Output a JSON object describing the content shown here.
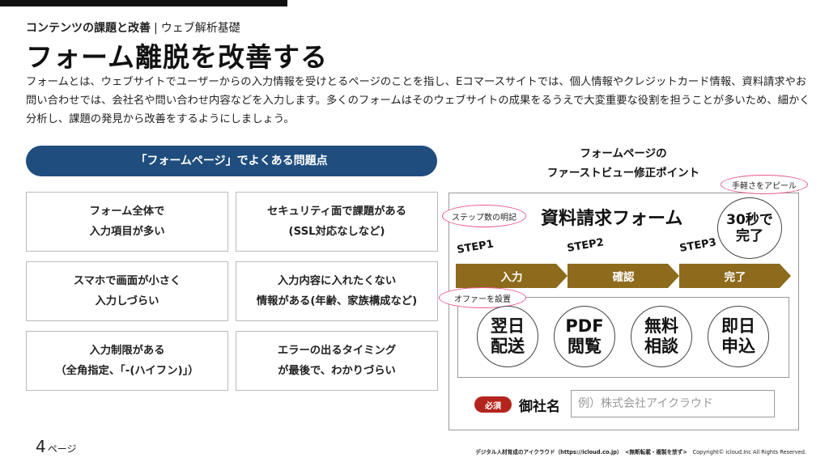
{
  "header": {
    "breadcrumb_main": "コンテンツの課題と改善",
    "breadcrumb_sep": "|",
    "breadcrumb_sub": "ウェブ解析基礎",
    "title": "フォーム離脱を改善する",
    "intro": "フォームとは、ウェブサイトでユーザーからの入力情報を受けとるページのことを指し、Eコマースサイトでは、個人情報やクレジットカード情報、資料請求やお問い合わせでは、会社名や問い合わせ内容などを入力します。多くのフォームはそのウェブサイトの成果をるうえで大変重要な役割を担うことが多いため、細かく分析し、課題の発見から改善をするようにしましょう。"
  },
  "problems": {
    "heading": "「フォームページ」でよくある問題点",
    "items": [
      "フォーム全体で\n入力項目が多い",
      "セキュリティ面で課題がある\n(SSL対応なしなど)",
      "スマホで画面が小さく\n入力しづらい",
      "入力内容に入れたくない\n情報がある(年齢、家族構成など)",
      "入力制限がある\n（全角指定、「-(ハイフン)」）",
      "エラーの出るタイミング\nが最後で、わかりづらい"
    ]
  },
  "firstview": {
    "title": "フォームページの\nファーストビュー修正ポイント",
    "form_title": "資料請求フォーム",
    "callouts": {
      "steps": "ステップ数の明記",
      "ease": "手軽さをアピール",
      "offer": "オファーを設置"
    },
    "promise": "30秒で\n完了",
    "steps": [
      {
        "label": "STEP1",
        "name": "入力"
      },
      {
        "label": "STEP2",
        "name": "確認"
      },
      {
        "label": "STEP3",
        "name": "完了"
      }
    ],
    "offers": [
      "翌日\n配送",
      "PDF\n閲覧",
      "無料\n相談",
      "即日\n申込"
    ],
    "field": {
      "required": "必須",
      "label": "御社名",
      "placeholder": "例）株式会社アイクラウド"
    }
  },
  "footer": {
    "page_number": "4",
    "page_unit": "ページ",
    "bold_text": "デジタル人材育成のアイクラウド（https://icloud.co.jp）　<無断転載・複製を禁ず>",
    "copyright": "Copyright© icloud.Inc All Rights Reserved."
  },
  "colors": {
    "navy": "#1e4d7e",
    "step_brown": "#8d6a1c",
    "callout_pink": "#e85a87",
    "required_red": "#b3251c"
  }
}
